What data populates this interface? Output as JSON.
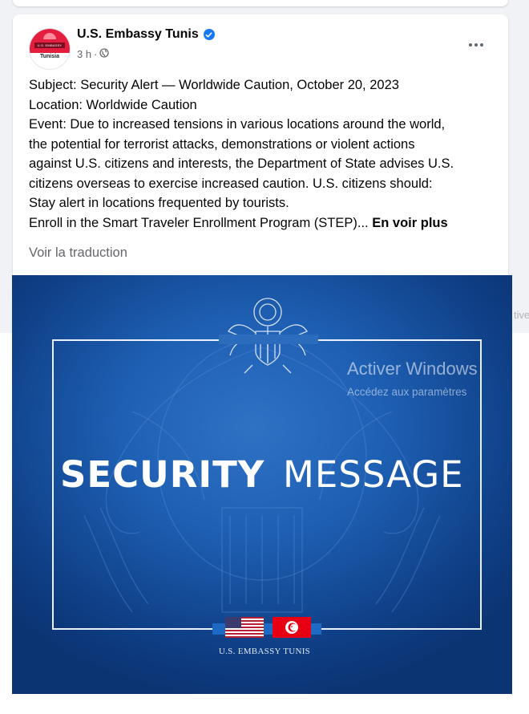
{
  "post": {
    "page_name": "U.S. Embassy Tunis",
    "time": "3 h",
    "meta_sep": "·",
    "avatar": {
      "band_text": "U.S. EMBASSY",
      "sub_text": "Tunisia"
    },
    "lines": [
      "Subject: Security Alert — Worldwide Caution, October 20, 2023",
      "Location: Worldwide Caution",
      "Event: Due to increased tensions in various locations around the world,",
      "the potential for terrorist attacks, demonstrations or violent actions",
      "against U.S. citizens and interests, the Department of State advises U.S.",
      "citizens overseas to exercise increased caution. U.S. citizens should:",
      "Stay alert in locations frequented by tourists."
    ],
    "last_line": "Enroll in the Smart Traveler Enrollment Program (STEP)...",
    "see_more": "En voir plus",
    "translate": "Voir la traduction"
  },
  "image": {
    "title_bold": "SECURITY",
    "title_light": "MESSAGE",
    "caption": "U.S. EMBASSY TUNIS"
  },
  "side_fragment": "tive",
  "watermark": {
    "title": "Activer Windows",
    "subtitle": "Accédez aux paramètres"
  },
  "colors": {
    "brand_blue": "#1877f2",
    "image_blue": "#1e5fb3",
    "tunisia_red": "#e70013"
  },
  "icons": {
    "verified": "verified-badge-icon",
    "privacy": "globe-icon",
    "menu": "more-options-icon"
  }
}
